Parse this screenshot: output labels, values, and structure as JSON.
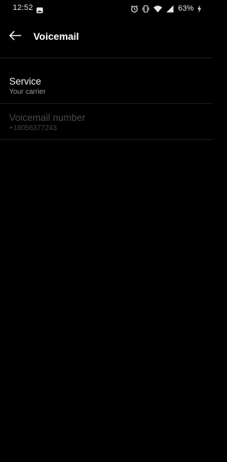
{
  "status_bar": {
    "time": "12:52",
    "notification_icon": "image-notification-icon",
    "icons": [
      "alarm-icon",
      "vibrate-icon",
      "wifi-icon",
      "signal-icon"
    ],
    "battery_percent": "63%",
    "charging_icon": "bolt-icon"
  },
  "app_bar": {
    "back_icon": "arrow-left-icon",
    "title": "Voicemail"
  },
  "preferences": {
    "service": {
      "title": "Service",
      "summary": "Your carrier",
      "enabled": true
    },
    "voicemail_number": {
      "title": "Voicemail number",
      "summary": "+18056377243",
      "enabled": false
    }
  },
  "colors": {
    "background": "#000000",
    "divider": "#1d1d1d",
    "primary_text": "#f2f2f2",
    "secondary_text": "#9a9a9a",
    "disabled_text": "#4a4a4a"
  }
}
